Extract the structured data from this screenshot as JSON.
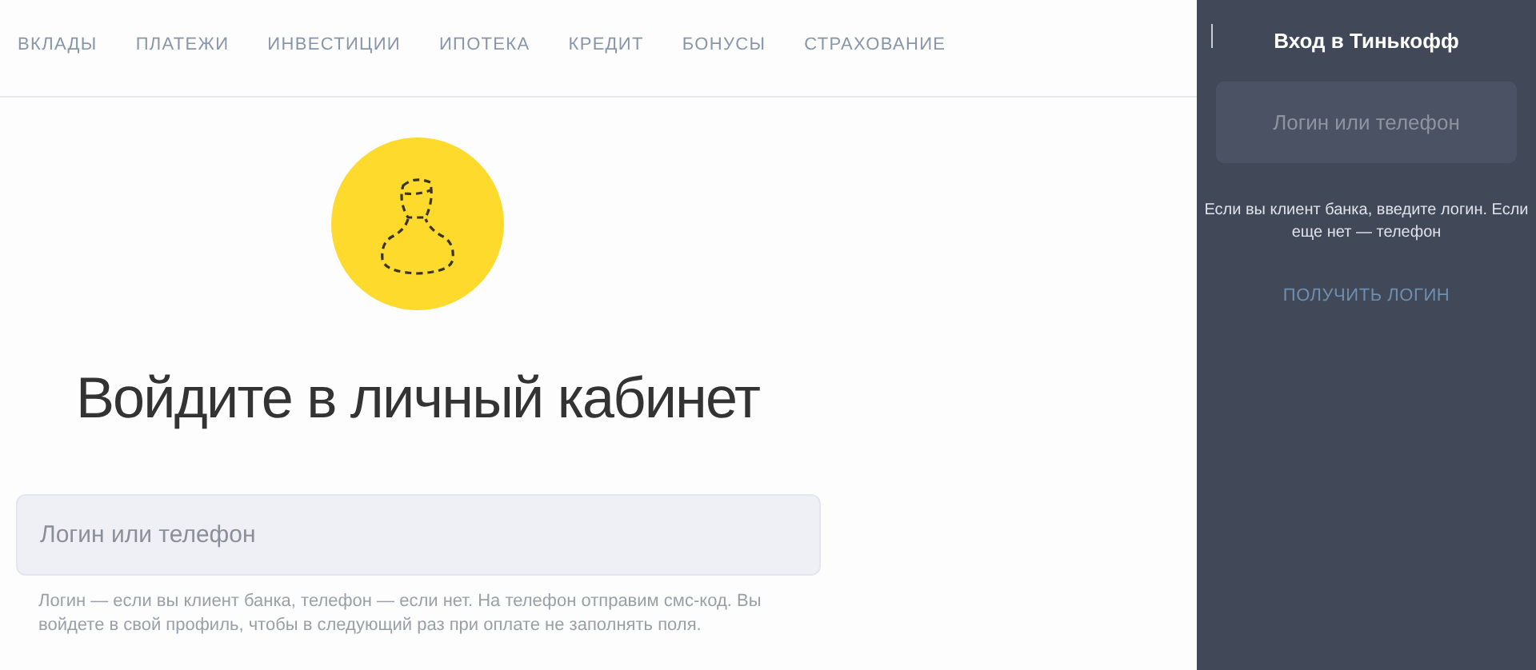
{
  "nav": {
    "items": [
      {
        "label": "ВКЛАДЫ"
      },
      {
        "label": "ПЛАТЕЖИ"
      },
      {
        "label": "ИНВЕСТИЦИИ"
      },
      {
        "label": "ИПОТЕКА"
      },
      {
        "label": "КРЕДИТ"
      },
      {
        "label": "БОНУСЫ"
      },
      {
        "label": "СТРАХОВАНИЕ"
      }
    ]
  },
  "main": {
    "heading": "Войдите в личный кабинет",
    "login_field": {
      "placeholder": "Логин или телефон"
    },
    "hint": "Логин — если вы клиент банка, телефон — если нет. На телефон отправим смс-код. Вы войдете в свой профиль, чтобы в следующий раз при оплате не заполнять поля."
  },
  "side_panel": {
    "title": "Вход в Тинькофф",
    "login_field": {
      "placeholder": "Логин или телефон"
    },
    "hint": "Если вы клиент банка, введите логин. Если еще нет — телефон",
    "link": "ПОЛУЧИТЬ ЛОГИН"
  }
}
